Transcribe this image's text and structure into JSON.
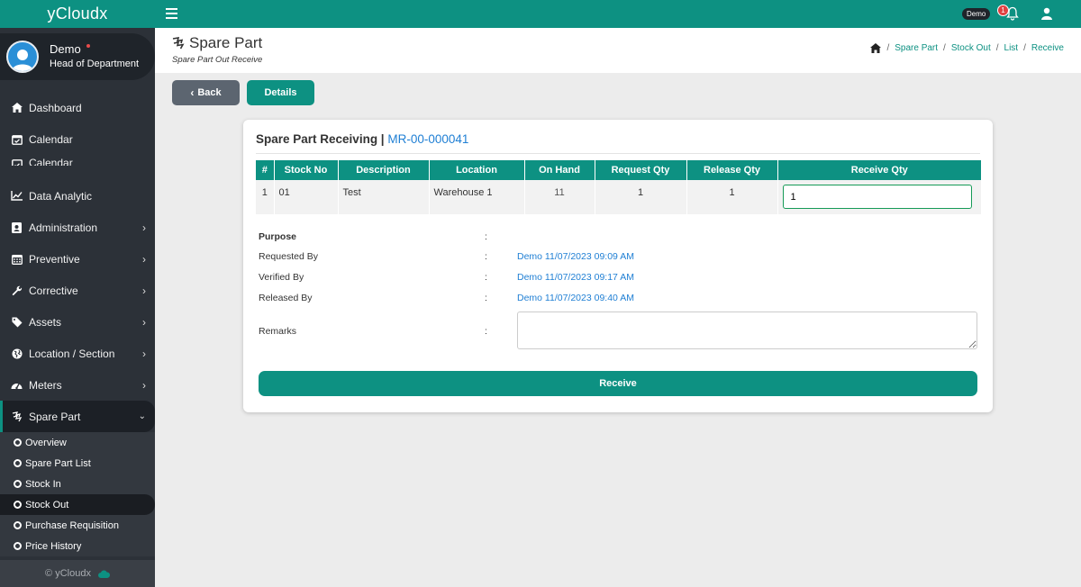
{
  "app": {
    "brand": "yCloudx",
    "footer": "© yCloudx"
  },
  "user": {
    "name": "Demo",
    "role": "Head of Department",
    "badge": "Demo",
    "notifications": "1"
  },
  "sidebar": {
    "items": [
      {
        "label": "Dashboard",
        "icon": "home-icon"
      },
      {
        "label": "Calendar",
        "icon": "calendar-icon"
      },
      {
        "label": "Calendar",
        "icon": "calendar-icon"
      },
      {
        "label": "Data Analytic",
        "icon": "chart-line-icon"
      },
      {
        "label": "Administration",
        "icon": "id-card-icon"
      },
      {
        "label": "Preventive",
        "icon": "calendar-grid-icon"
      },
      {
        "label": "Corrective",
        "icon": "wrench-icon"
      },
      {
        "label": "Assets",
        "icon": "tag-icon"
      },
      {
        "label": "Location / Section",
        "icon": "globe-icon"
      },
      {
        "label": "Meters",
        "icon": "gauge-icon"
      },
      {
        "label": "Spare Part",
        "icon": "spare-part-icon"
      }
    ],
    "subitems": [
      {
        "label": "Overview"
      },
      {
        "label": "Spare Part List"
      },
      {
        "label": "Stock In"
      },
      {
        "label": "Stock Out"
      },
      {
        "label": "Purchase Requisition"
      },
      {
        "label": "Price History"
      }
    ]
  },
  "header": {
    "title": "Spare Part",
    "subtitle": "Spare Part Out Receive",
    "breadcrumb": [
      "Spare Part",
      "Stock Out",
      "List",
      "Receive"
    ]
  },
  "buttons": {
    "back": "Back",
    "details": "Details",
    "receive": "Receive"
  },
  "card": {
    "title": "Spare Part Receiving |",
    "ref": "MR-00-000041",
    "columns": [
      "#",
      "Stock No",
      "Description",
      "Location",
      "On Hand",
      "Request Qty",
      "Release Qty",
      "Receive Qty"
    ],
    "rows": [
      {
        "no": "1",
        "stock_no": "01",
        "description": "Test",
        "location": "Warehouse 1",
        "on_hand": "11",
        "request_qty": "1",
        "release_qty": "1",
        "receive_qty": "1"
      }
    ],
    "info": {
      "purpose_label": "Purpose",
      "requested_label": "Requested By",
      "requested_value": "Demo 11/07/2023 09:09 AM",
      "verified_label": "Verified By",
      "verified_value": "Demo 11/07/2023 09:17 AM",
      "released_label": "Released By",
      "released_value": "Demo 11/07/2023 09:40 AM",
      "remarks_label": "Remarks",
      "colon": ":"
    }
  },
  "colors": {
    "teal": "#0d9182",
    "sidebar": "#2c3138",
    "link": "#1f7fd4"
  }
}
